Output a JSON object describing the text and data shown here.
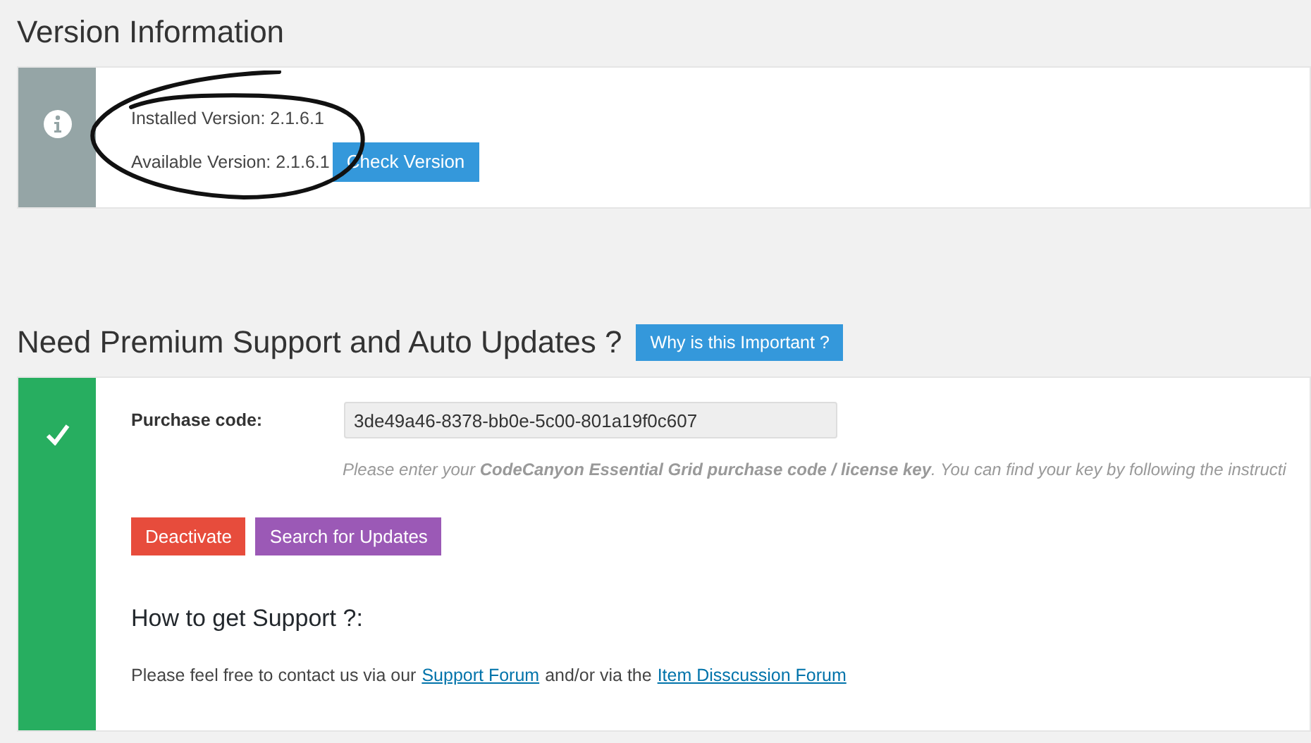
{
  "version_section": {
    "title": "Version Information",
    "installed": "Installed Version: 2.1.6.1",
    "available": "Available Version: 2.1.6.1",
    "check_button": "Check Version"
  },
  "support_section": {
    "title": "Need Premium Support and Auto Updates ?",
    "why_button": "Why is this Important ?",
    "activated": true,
    "purchase_label": "Purchase code:",
    "purchase_value": "3de49a46-8378-bb0e-5c00-801a19f0c607",
    "hint": "Please enter your **CodeCanyon Essential Grid purchase code / license key**. You can find your key by following the instructi",
    "deactivate_button": "Deactivate",
    "search_button": "Search for Updates",
    "help_title": "How to get Support ?:",
    "help_text_1": "Please feel free to contact us via our",
    "help_link_1": "Support Forum",
    "help_text_2": "and/or via the",
    "help_link_2": "Item Disscussion Forum"
  }
}
